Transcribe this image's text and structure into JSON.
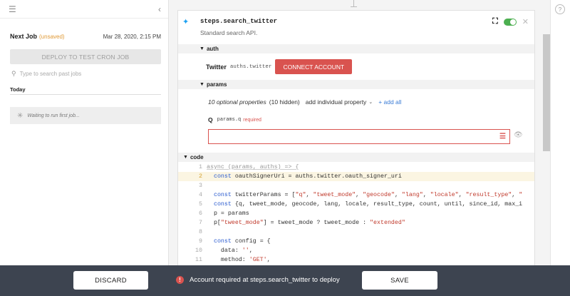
{
  "left_panel": {
    "next_job_label": "Next Job",
    "unsaved_label": "(unsaved)",
    "next_job_date": "Mar 28, 2020, 2:15 PM",
    "deploy_button": "DEPLOY TO TEST CRON JOB",
    "search_placeholder": "Type to search past jobs",
    "today_label": "Today",
    "waiting_text": "Waiting to run first job..."
  },
  "step": {
    "name": "steps.search_twitter",
    "description": "Standard search API.",
    "icon": "twitter-icon",
    "enabled": true
  },
  "auth": {
    "section_label": "auth",
    "service": "Twitter",
    "service_code": "auths.twitter",
    "connect_button": "CONNECT ACCOUNT"
  },
  "params": {
    "section_label": "params",
    "optional_props": "10 optional properties",
    "hidden": "(10 hidden)",
    "add_property": "add individual property",
    "add_all": "+ add all",
    "q_label": "Q",
    "q_path": "params.q",
    "q_required": "required",
    "q_value": ""
  },
  "code": {
    "section_label": "code",
    "lines": [
      {
        "n": "1",
        "t": "async (params, auths) => {"
      },
      {
        "n": "2",
        "t": "  const oauthSignerUri = auths.twitter.oauth_signer_uri"
      },
      {
        "n": "3",
        "t": ""
      },
      {
        "n": "4",
        "t": "  const twitterParams = [\"q\", \"tweet_mode\", \"geocode\", \"lang\", \"locale\", \"result_type\", \""
      },
      {
        "n": "5",
        "t": "  const {q, tweet_mode, geocode, lang, locale, result_type, count, until, since_id, max_i"
      },
      {
        "n": "6",
        "t": "  p = params"
      },
      {
        "n": "7",
        "t": "  p[\"tweet_mode\"] = tweet_mode ? tweet_mode : \"extended\""
      },
      {
        "n": "8",
        "t": ""
      },
      {
        "n": "9",
        "t": "  const config = {"
      },
      {
        "n": "10",
        "t": "    data: '',"
      },
      {
        "n": "11",
        "t": "    method: 'GET',"
      }
    ]
  },
  "bottom_bar": {
    "discard": "DISCARD",
    "warning": "Account required at steps.search_twitter to deploy",
    "save": "SAVE"
  },
  "colors": {
    "accent_red": "#d9534f",
    "twitter_blue": "#1da1f2",
    "toggle_green": "#4caf50",
    "bottom_bar": "#3d4450"
  }
}
